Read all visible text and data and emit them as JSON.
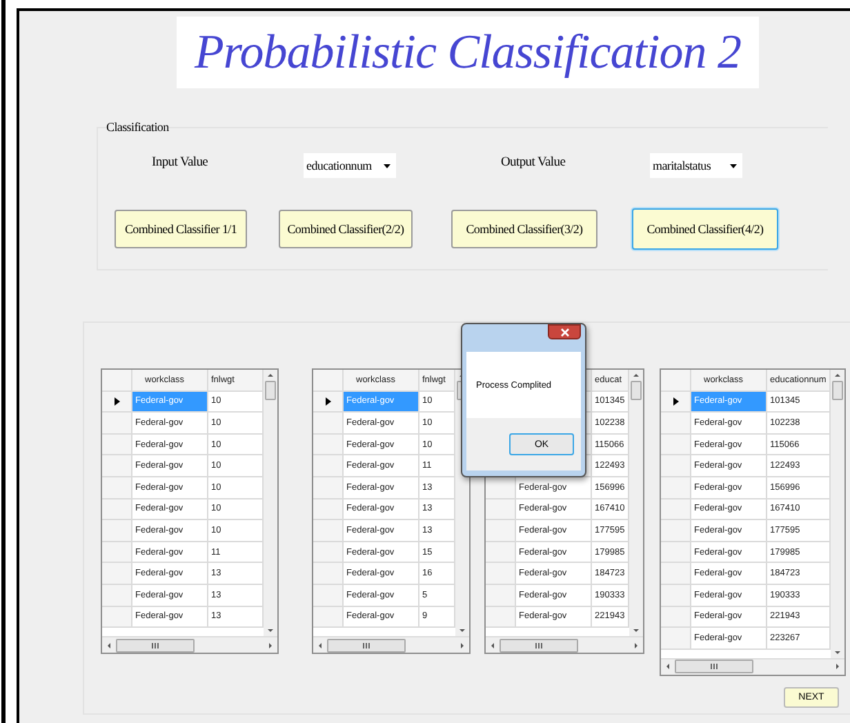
{
  "title": "Probabilistic Classification 2",
  "classification": {
    "label": "Classification",
    "input_label": "Input Value",
    "input_value": "educationnum",
    "output_label": "Output Value",
    "output_value": "maritalstatus",
    "buttons": [
      {
        "label": "Combined Classifier 1/1",
        "focused": false
      },
      {
        "label": "Combined Classifier(2/2)",
        "focused": false
      },
      {
        "label": "Combined Classifier(3/2)",
        "focused": false
      },
      {
        "label": "Combined Classifier(4/2)",
        "focused": true
      }
    ]
  },
  "grids": [
    {
      "columns": [
        "workclass",
        "fnlwgt"
      ],
      "rows": [
        {
          "selected": true,
          "cells": [
            "Federal-gov",
            "10"
          ]
        },
        {
          "selected": false,
          "cells": [
            "Federal-gov",
            "10"
          ]
        },
        {
          "selected": false,
          "cells": [
            "Federal-gov",
            "10"
          ]
        },
        {
          "selected": false,
          "cells": [
            "Federal-gov",
            "10"
          ]
        },
        {
          "selected": false,
          "cells": [
            "Federal-gov",
            "10"
          ]
        },
        {
          "selected": false,
          "cells": [
            "Federal-gov",
            "10"
          ]
        },
        {
          "selected": false,
          "cells": [
            "Federal-gov",
            "10"
          ]
        },
        {
          "selected": false,
          "cells": [
            "Federal-gov",
            "11"
          ]
        },
        {
          "selected": false,
          "cells": [
            "Federal-gov",
            "13"
          ]
        },
        {
          "selected": false,
          "cells": [
            "Federal-gov",
            "13"
          ]
        },
        {
          "selected": false,
          "cells": [
            "Federal-gov",
            "13"
          ]
        }
      ]
    },
    {
      "columns": [
        "workclass",
        "fnlwgt"
      ],
      "rows": [
        {
          "selected": true,
          "cells": [
            "Federal-gov",
            "10"
          ]
        },
        {
          "selected": false,
          "cells": [
            "Federal-gov",
            "10"
          ]
        },
        {
          "selected": false,
          "cells": [
            "Federal-gov",
            "10"
          ]
        },
        {
          "selected": false,
          "cells": [
            "Federal-gov",
            "11"
          ]
        },
        {
          "selected": false,
          "cells": [
            "Federal-gov",
            "13"
          ]
        },
        {
          "selected": false,
          "cells": [
            "Federal-gov",
            "13"
          ]
        },
        {
          "selected": false,
          "cells": [
            "Federal-gov",
            "13"
          ]
        },
        {
          "selected": false,
          "cells": [
            "Federal-gov",
            "15"
          ]
        },
        {
          "selected": false,
          "cells": [
            "Federal-gov",
            "16"
          ]
        },
        {
          "selected": false,
          "cells": [
            "Federal-gov",
            "5"
          ]
        },
        {
          "selected": false,
          "cells": [
            "Federal-gov",
            "9"
          ]
        }
      ]
    },
    {
      "columns": [
        null,
        "educat"
      ],
      "rows": [
        {
          "cells": [
            null,
            "101345"
          ]
        },
        {
          "cells": [
            null,
            "102238"
          ]
        },
        {
          "cells": [
            null,
            "115066"
          ]
        },
        {
          "cells": [
            null,
            "122493"
          ]
        },
        {
          "cells": [
            "Federal-gov",
            "156996"
          ]
        },
        {
          "cells": [
            "Federal-gov",
            "167410"
          ]
        },
        {
          "cells": [
            "Federal-gov",
            "177595"
          ]
        },
        {
          "cells": [
            "Federal-gov",
            "179985"
          ]
        },
        {
          "cells": [
            "Federal-gov",
            "184723"
          ]
        },
        {
          "cells": [
            "Federal-gov",
            "190333"
          ]
        },
        {
          "cells": [
            "Federal-gov",
            "221943"
          ]
        }
      ]
    },
    {
      "columns": [
        "workclass",
        "educationnum"
      ],
      "rows": [
        {
          "selected": true,
          "cells": [
            "Federal-gov",
            "101345"
          ]
        },
        {
          "selected": false,
          "cells": [
            "Federal-gov",
            "102238"
          ]
        },
        {
          "selected": false,
          "cells": [
            "Federal-gov",
            "115066"
          ]
        },
        {
          "selected": false,
          "cells": [
            "Federal-gov",
            "122493"
          ]
        },
        {
          "selected": false,
          "cells": [
            "Federal-gov",
            "156996"
          ]
        },
        {
          "selected": false,
          "cells": [
            "Federal-gov",
            "167410"
          ]
        },
        {
          "selected": false,
          "cells": [
            "Federal-gov",
            "177595"
          ]
        },
        {
          "selected": false,
          "cells": [
            "Federal-gov",
            "179985"
          ]
        },
        {
          "selected": false,
          "cells": [
            "Federal-gov",
            "184723"
          ]
        },
        {
          "selected": false,
          "cells": [
            "Federal-gov",
            "190333"
          ]
        },
        {
          "selected": false,
          "cells": [
            "Federal-gov",
            "221943"
          ]
        },
        {
          "selected": false,
          "cells": [
            "Federal-gov",
            "223267"
          ]
        }
      ]
    }
  ],
  "dialog": {
    "message": "Process Complited",
    "button": "OK"
  },
  "next_button": "NEXT"
}
